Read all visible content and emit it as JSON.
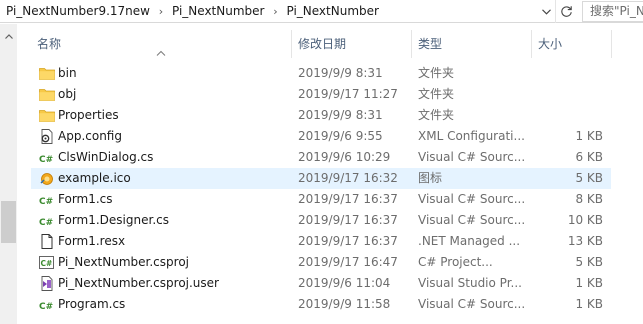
{
  "address_bar": {
    "crumbs": [
      "Pi_NextNumber9.17new",
      "Pi_NextNumber",
      "Pi_NextNumber"
    ],
    "separator_glyph": "›",
    "search_placeholder": "搜索\"Pi_N"
  },
  "columns": {
    "name": "名称",
    "date": "修改日期",
    "type": "类型",
    "size": "大小"
  },
  "files": [
    {
      "name": "bin",
      "date": "2019/9/9 8:31",
      "type": "文件夹",
      "size": "",
      "icon": "folder-icon"
    },
    {
      "name": "obj",
      "date": "2019/9/17 11:27",
      "type": "文件夹",
      "size": "",
      "icon": "folder-icon"
    },
    {
      "name": "Properties",
      "date": "2019/9/9 8:31",
      "type": "文件夹",
      "size": "",
      "icon": "folder-icon"
    },
    {
      "name": "App.config",
      "date": "2019/9/6 9:55",
      "type": "XML Configurati...",
      "size": "1 KB",
      "icon": "config-file-icon"
    },
    {
      "name": "ClsWinDialog.cs",
      "date": "2019/9/6 10:29",
      "type": "Visual C# Sourc...",
      "size": "6 KB",
      "icon": "csharp-file-icon"
    },
    {
      "name": "example.ico",
      "date": "2019/9/17 16:32",
      "type": "图标",
      "size": "5 KB",
      "icon": "ico-file-icon",
      "highlighted": true
    },
    {
      "name": "Form1.cs",
      "date": "2019/9/17 16:37",
      "type": "Visual C# Sourc...",
      "size": "8 KB",
      "icon": "csharp-file-icon"
    },
    {
      "name": "Form1.Designer.cs",
      "date": "2019/9/17 16:37",
      "type": "Visual C# Sourc...",
      "size": "10 KB",
      "icon": "csharp-file-icon"
    },
    {
      "name": "Form1.resx",
      "date": "2019/9/17 16:37",
      "type": ".NET Managed ...",
      "size": "13 KB",
      "icon": "resx-file-icon"
    },
    {
      "name": "Pi_NextNumber.csproj",
      "date": "2019/9/17 16:47",
      "type": "C# Project...",
      "size": "5 KB",
      "icon": "csproj-file-icon"
    },
    {
      "name": "Pi_NextNumber.csproj.user",
      "date": "2019/9/6 11:04",
      "type": "Visual Studio Pr...",
      "size": "1 KB",
      "icon": "vs-user-file-icon"
    },
    {
      "name": "Program.cs",
      "date": "2019/9/9 11:58",
      "type": "Visual C# Sourc...",
      "size": "1 KB",
      "icon": "csharp-file-icon"
    }
  ],
  "colors": {
    "highlight": "#e5f3ff",
    "folder": "#f7c948",
    "csharp": "#3a8a2e",
    "header_text": "#4c607a"
  }
}
